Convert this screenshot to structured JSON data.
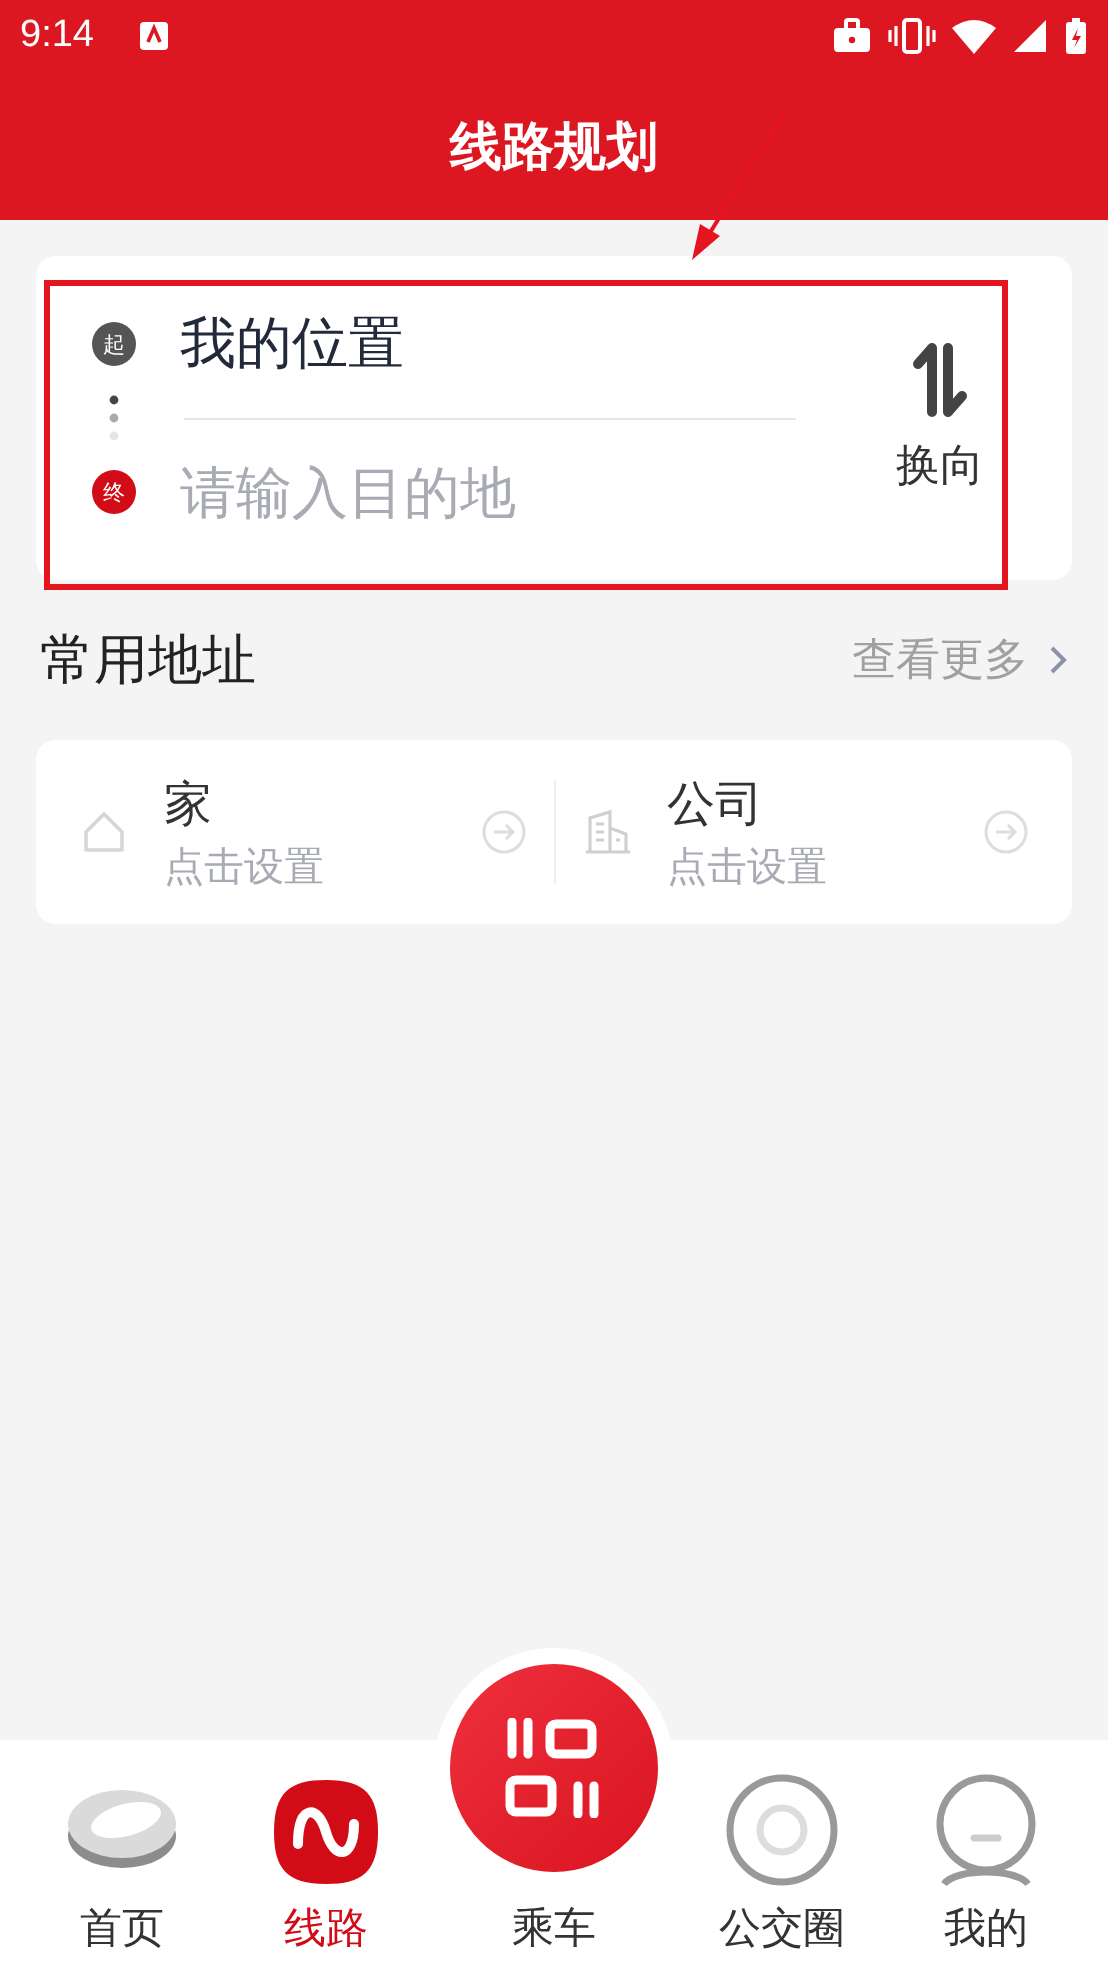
{
  "status_bar": {
    "time": "9:14"
  },
  "header": {
    "title": "线路规划"
  },
  "route": {
    "start": {
      "marker": "起",
      "value": "我的位置"
    },
    "end": {
      "marker": "终",
      "placeholder": "请输入目的地"
    },
    "swap_label": "换向"
  },
  "common_addresses": {
    "title": "常用地址",
    "more": "查看更多",
    "items": [
      {
        "kind": "home",
        "name": "家",
        "hint": "点击设置"
      },
      {
        "kind": "company",
        "name": "公司",
        "hint": "点击设置"
      }
    ]
  },
  "nav": [
    {
      "kind": "home",
      "label": "首页",
      "selected": false
    },
    {
      "kind": "route",
      "label": "线路",
      "selected": true
    },
    {
      "kind": "ride",
      "label": "乘车",
      "selected": false
    },
    {
      "kind": "circle",
      "label": "公交圈",
      "selected": false
    },
    {
      "kind": "mine",
      "label": "我的",
      "selected": false
    }
  ]
}
